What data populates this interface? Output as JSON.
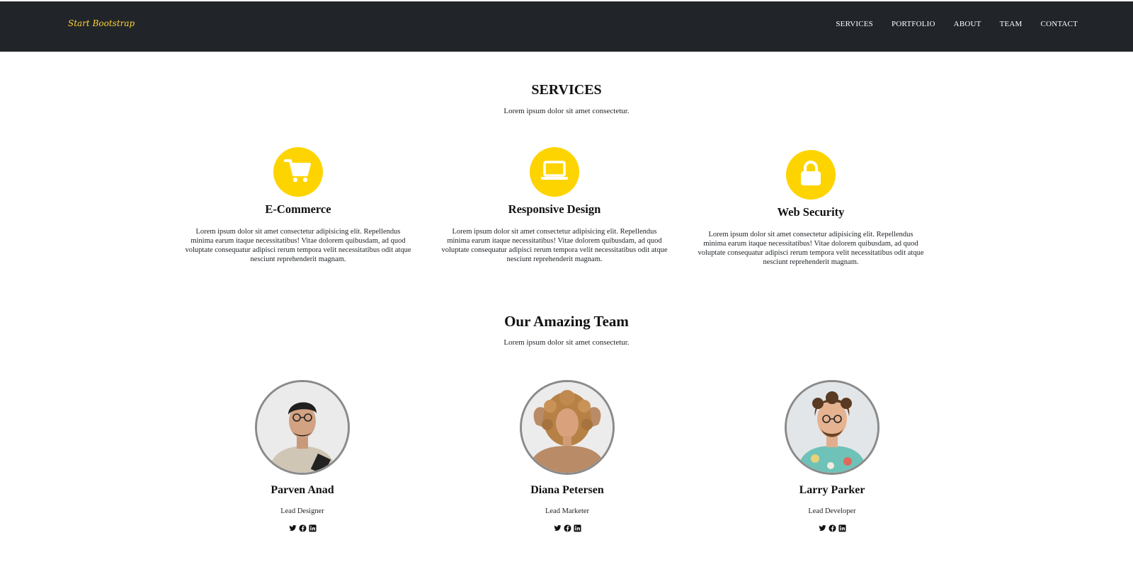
{
  "navbar": {
    "brand": "Start Bootstrap",
    "links": [
      "SERVICES",
      "PORTFOLIO",
      "ABOUT",
      "TEAM",
      "CONTACT"
    ]
  },
  "services": {
    "title": "SERVICES",
    "subtitle": "Lorem ipsum dolor sit amet consectetur.",
    "items": [
      {
        "icon": "shopping-cart-icon",
        "title": "E-Commerce",
        "text": "Lorem ipsum dolor sit amet consectetur adipisicing elit. Repellendus minima earum itaque necessitatibus! Vitae dolorem quibusdam, ad quod voluptate consequatur adipisci rerum tempora velit necessitatibus odit atque nesciunt reprehenderit magnam."
      },
      {
        "icon": "laptop-icon",
        "title": "Responsive Design",
        "text": "Lorem ipsum dolor sit amet consectetur adipisicing elit. Repellendus minima earum itaque necessitatibus! Vitae dolorem quibusdam, ad quod voluptate consequatur adipisci rerum tempora velit necessitatibus odit atque nesciunt reprehenderit magnam."
      },
      {
        "icon": "lock-icon",
        "title": "Web Security",
        "text": "Lorem ipsum dolor sit amet consectetur adipisicing elit. Repellendus minima earum itaque necessitatibus! Vitae dolorem quibusdam, ad quod voluptate consequatur adipisci rerum tempora velit necessitatibus odit atque nesciunt reprehenderit magnam."
      }
    ]
  },
  "team": {
    "title": "Our Amazing Team",
    "subtitle": "Lorem ipsum dolor sit amet consectetur.",
    "members": [
      {
        "name": "Parven Anad",
        "role": "Lead Designer"
      },
      {
        "name": "Diana Petersen",
        "role": "Lead Marketer"
      },
      {
        "name": "Larry Parker",
        "role": "Lead Developer"
      }
    ],
    "social_icons": [
      "twitter-icon",
      "facebook-icon",
      "linkedin-icon"
    ]
  },
  "colors": {
    "navbar_bg": "#212529",
    "accent": "#fed400",
    "brand": "#fed136"
  }
}
